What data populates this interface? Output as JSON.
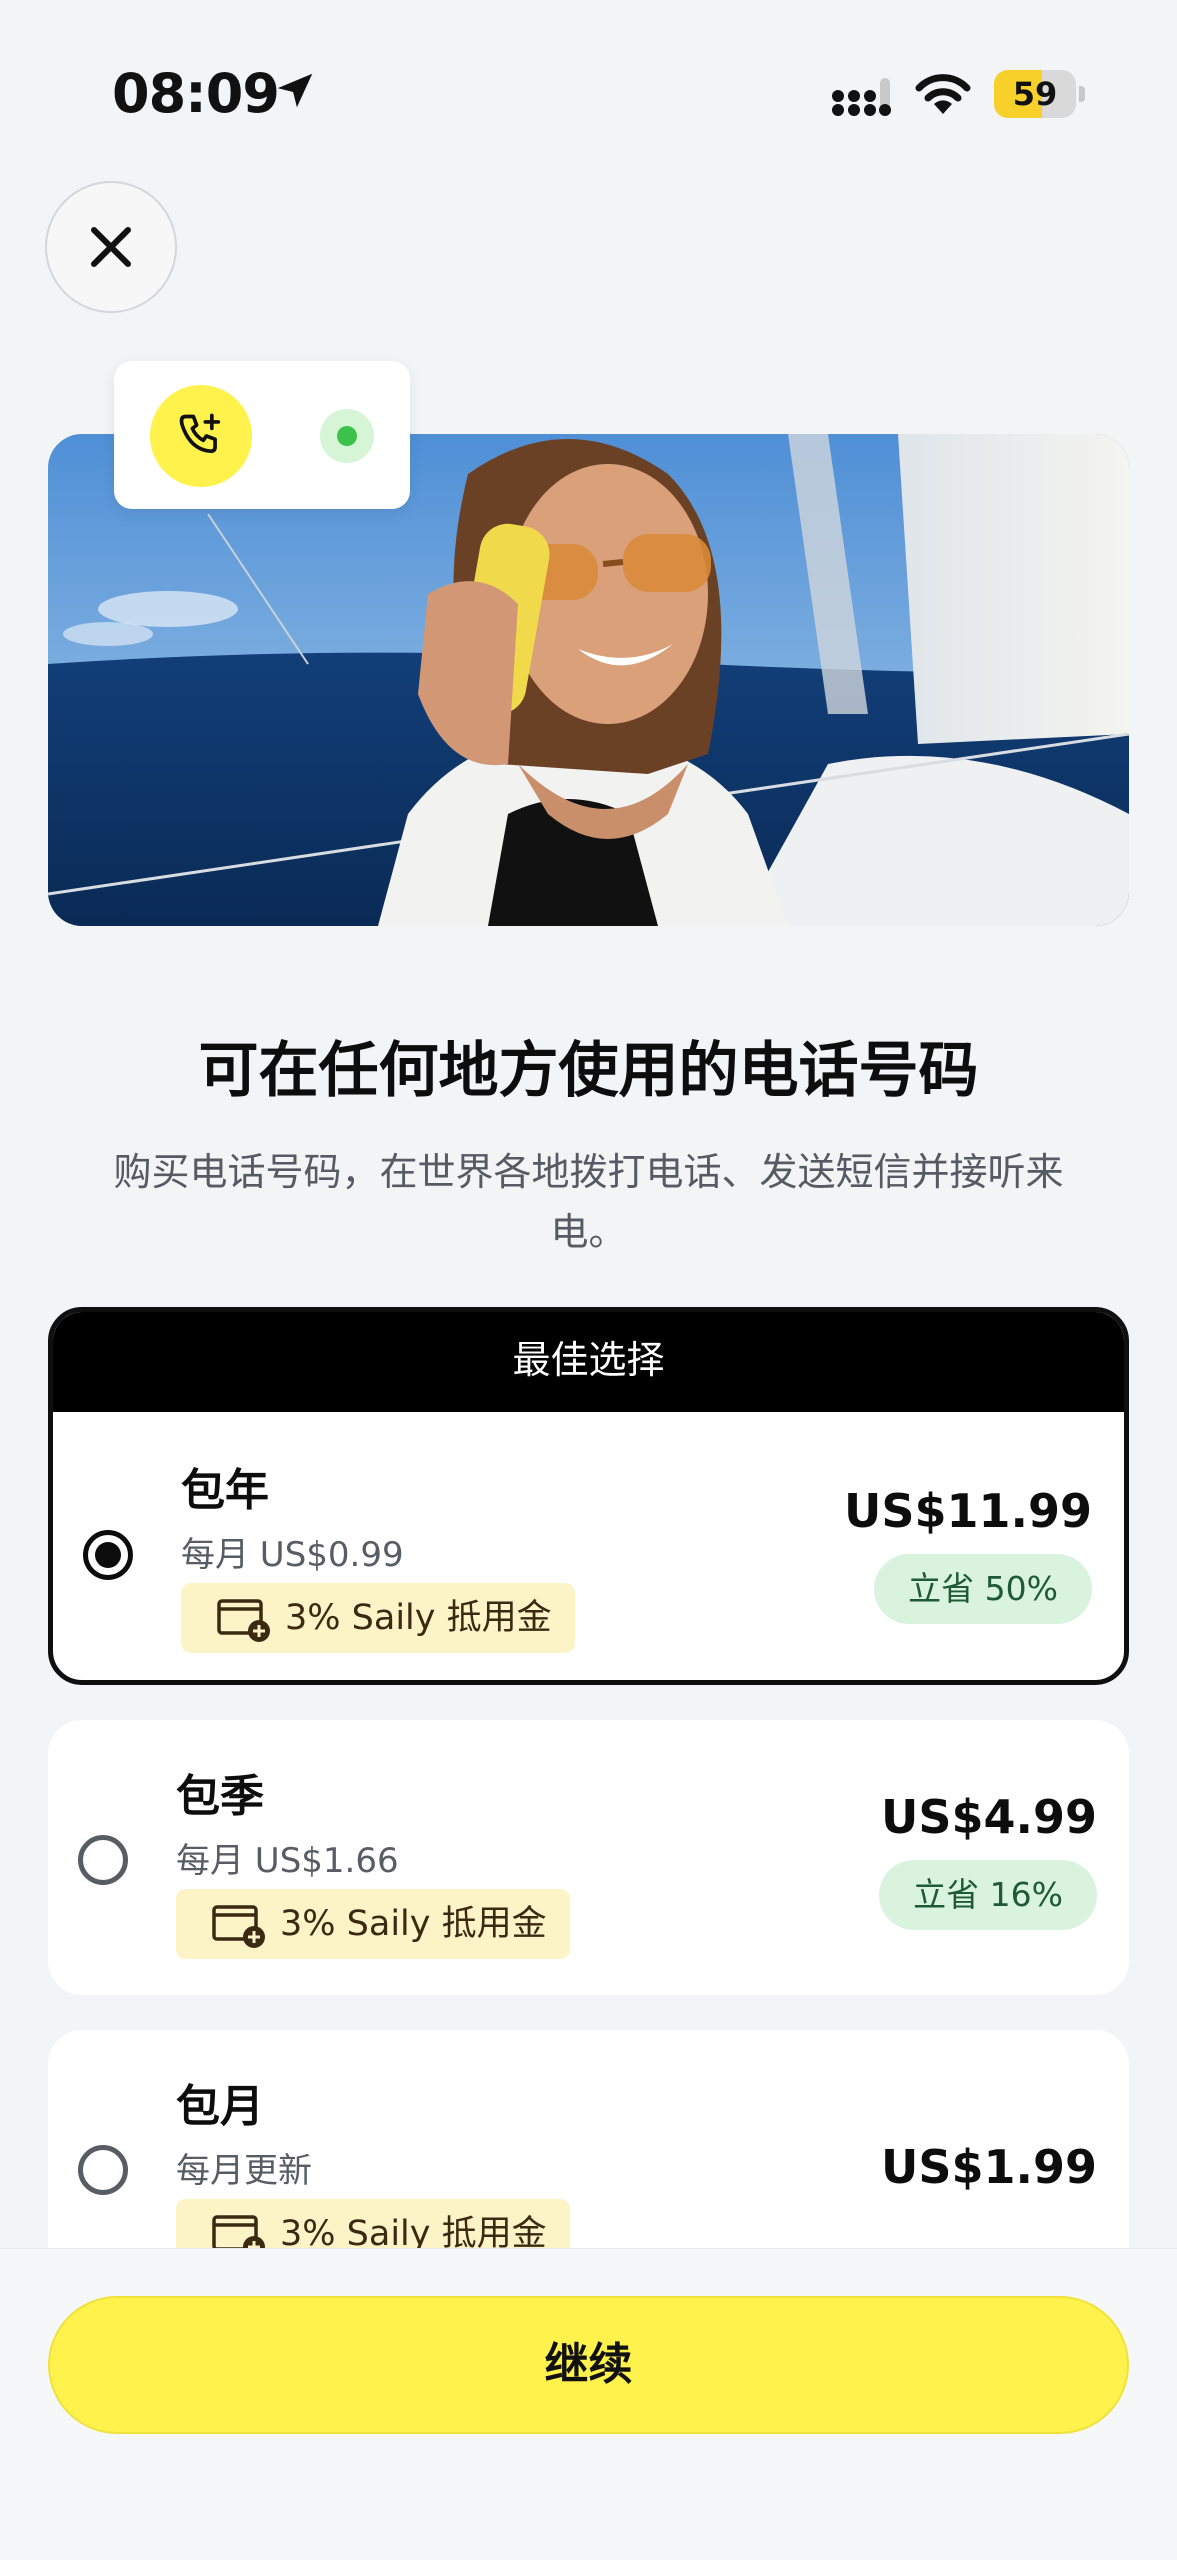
{
  "status_bar": {
    "time": "08:09",
    "battery": "59",
    "battery_level": 0.59,
    "location_icon": "location-arrow-icon",
    "signal_icon": "cellular-signal-icon",
    "wifi_icon": "wifi-icon"
  },
  "close_button": {
    "icon": "close-icon"
  },
  "hero": {
    "image": "woman-on-phone-sailboat",
    "call_icon": "phone-plus-icon",
    "status_dot": "online-indicator"
  },
  "title": "可在任何地方使用的电话号码",
  "subtitle": "购买电话号码，在世界各地拨打电话、发送短信并接听来电。",
  "plans": [
    {
      "badge": "最佳选择",
      "name": "包年",
      "sub": "每月 US$0.99",
      "cashback": "3% Saily 抵用金",
      "price": "US$11.99",
      "save": "立省 50%",
      "selected": true
    },
    {
      "name": "包季",
      "sub": "每月 US$1.66",
      "cashback": "3% Saily 抵用金",
      "price": "US$4.99",
      "save": "立省 16%",
      "selected": false
    },
    {
      "name": "包月",
      "sub": "每月更新",
      "cashback": "3% Saily 抵用金",
      "price": "US$1.99",
      "selected": false
    }
  ],
  "continue_label": "继续",
  "colors": {
    "accent_yellow": "#fff24c",
    "save_green_bg": "#d9f3df",
    "save_green_text": "#1e5a36",
    "cashback_bg": "#fcf3c7",
    "background": "#f3f4f6"
  }
}
